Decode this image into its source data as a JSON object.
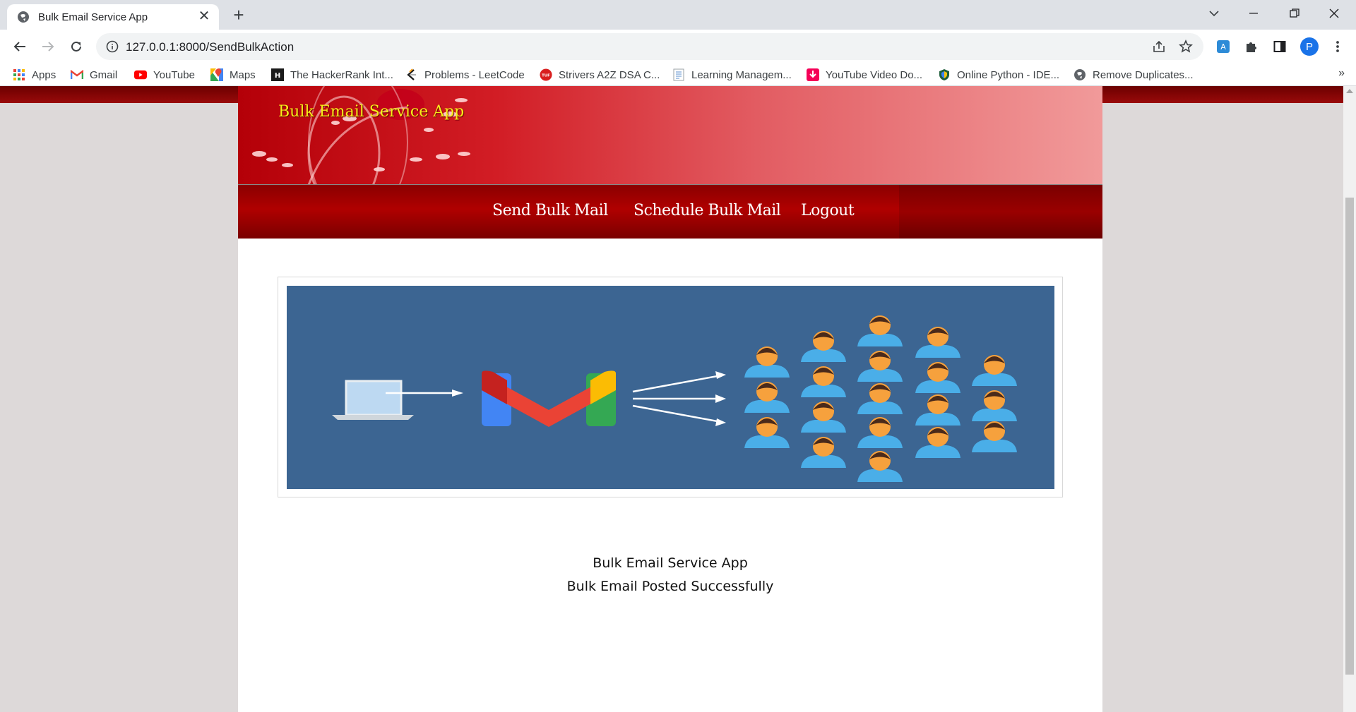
{
  "browser": {
    "tab_title": "Bulk Email Service App",
    "tab_close": "✕",
    "new_tab": "+",
    "url": "127.0.0.1:8000/SendBulkAction",
    "profile_initial": "P",
    "bookmarks": [
      {
        "label": "Apps",
        "icon": "apps-grid-icon"
      },
      {
        "label": "Gmail",
        "icon": "gmail-icon"
      },
      {
        "label": "YouTube",
        "icon": "youtube-icon"
      },
      {
        "label": "Maps",
        "icon": "maps-icon"
      },
      {
        "label": "The HackerRank Int...",
        "icon": "hackerrank-icon"
      },
      {
        "label": "Problems - LeetCode",
        "icon": "leetcode-icon"
      },
      {
        "label": "Strivers A2Z DSA C...",
        "icon": "tuf-icon"
      },
      {
        "label": "Learning Managem...",
        "icon": "document-icon"
      },
      {
        "label": "YouTube Video Do...",
        "icon": "download-icon"
      },
      {
        "label": "Online Python - IDE...",
        "icon": "python-shield-icon"
      },
      {
        "label": "Remove Duplicates...",
        "icon": "globe-icon"
      }
    ],
    "bookmarks_more": "»"
  },
  "page": {
    "site_title": "Bulk Email Service App",
    "menu": {
      "send": "Send Bulk Mail",
      "schedule": "Schedule Bulk Mail",
      "logout": "Logout"
    },
    "message_line1": "Bulk Email Service App",
    "message_line2": "Bulk Email Posted Successfully"
  },
  "colors": {
    "header_red": "#d21d25",
    "menu_red": "#9a0000",
    "title_yellow": "#f7ee1a",
    "banner_blue": "#3c6592"
  }
}
